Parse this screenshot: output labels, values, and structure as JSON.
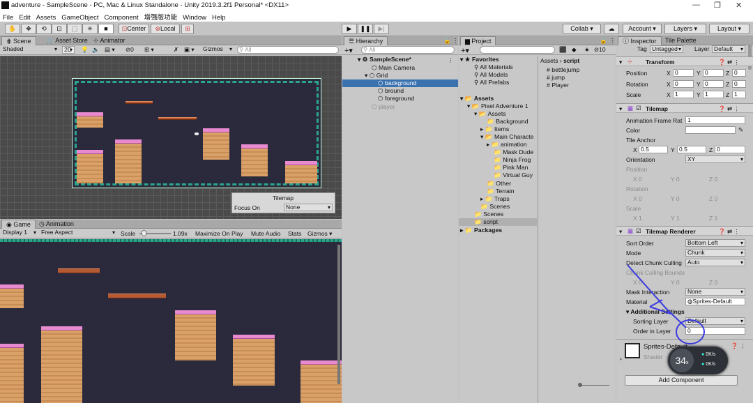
{
  "window": {
    "title": "adventure - SampleScene - PC, Mac & Linux Standalone - Unity 2019.3.2f1 Personal* <DX11>"
  },
  "menu": [
    "File",
    "Edit",
    "Assets",
    "GameObject",
    "Component",
    "增强版功能",
    "Window",
    "Help"
  ],
  "toolbar": {
    "center": "Center",
    "local": "Local",
    "collab": "Collab ▾",
    "account": "Account",
    "layers": "Layers",
    "layout": "Layout"
  },
  "scene": {
    "tabs": [
      "Scene",
      "Asset Store",
      "Animator"
    ],
    "shading": "Shaded",
    "mode2d": "2D",
    "hidden_count": "0",
    "gizmos": "Gizmos",
    "search_placeholder": "All",
    "tilemap_overlay": {
      "title": "Tilemap",
      "focus_label": "Focus On",
      "focus_value": "None"
    }
  },
  "game": {
    "tabs": [
      "Game",
      "Animation"
    ],
    "display": "Display 1",
    "aspect": "Free Aspect",
    "scale_label": "Scale",
    "scale_value": "1.09x",
    "maximize": "Maximize On Play",
    "mute": "Mute Audio",
    "stats": "Stats",
    "gizmos": "Gizmos"
  },
  "hierarchy": {
    "tab": "Hierarchy",
    "search_placeholder": "All",
    "items": [
      "SampleScene*",
      "Main Camera",
      "Grid",
      "background",
      "bround",
      "foreground",
      "player"
    ]
  },
  "project": {
    "tab": "Project",
    "hidden_count": "10",
    "tree": [
      "Favorites",
      "All Materials",
      "All Models",
      "All Prefabs",
      "Assets",
      "Pixel Adventure 1",
      "Assets",
      "Background",
      "Items",
      "Main Characte",
      "animation",
      "Mask Dude",
      "Ninja Frog",
      "Pink Man",
      "Virtual Guy",
      "Other",
      "Terrain",
      "Traps",
      "Scenes",
      "Scenes",
      "script",
      "Packages"
    ],
    "breadcrumb": [
      "Assets",
      "script"
    ],
    "files": [
      "bettlejump",
      "jump",
      "Player"
    ]
  },
  "inspector": {
    "tabs": [
      "Inspector",
      "Tile Palette"
    ],
    "tag_label": "Tag",
    "tag_value": "Untagged",
    "layer_label": "Layer",
    "layer_value": "Default",
    "transform": {
      "title": "Transform",
      "position": {
        "label": "Position",
        "x": "0",
        "y": "0",
        "z": "0"
      },
      "rotation": {
        "label": "Rotation",
        "x": "0",
        "y": "0",
        "z": "0"
      },
      "scale": {
        "label": "Scale",
        "x": "1",
        "y": "1",
        "z": "1"
      }
    },
    "tilemap": {
      "title": "Tilemap",
      "frame_rate_label": "Animation Frame Rat",
      "frame_rate": "1",
      "color_label": "Color",
      "anchor_label": "Tile Anchor",
      "anchor_x": "0.5",
      "anchor_y": "0.5",
      "anchor_z": "0",
      "orientation_label": "Orientation",
      "orientation": "XY",
      "position_label": "Position",
      "rotation_label": "Rotation",
      "scale_label": "Scale",
      "pos": [
        "0",
        "0",
        "0"
      ],
      "rot": [
        "0",
        "0",
        "0"
      ],
      "scl": [
        "1",
        "1",
        "1"
      ]
    },
    "renderer": {
      "title": "Tilemap Renderer",
      "sort_order_label": "Sort Order",
      "sort_order": "Bottom Left",
      "mode_label": "Mode",
      "mode": "Chunk",
      "culling_label": "Detect Chunk Culling",
      "culling": "Auto",
      "bounds_label": "Chunk Culling Bounds",
      "bounds": [
        "0",
        "0",
        "0"
      ],
      "mask_label": "Mask Interaction",
      "mask": "None",
      "material_label": "Material",
      "material": "Sprites-Default",
      "additional": "Additional Settings",
      "sorting_layer_label": "Sorting Layer",
      "sorting_layer": "Default",
      "order_label": "Order in Layer",
      "order": "0"
    },
    "material_preview": {
      "name": "Sprites-Default",
      "shader_label": "Shader"
    },
    "add_component": "Add Component"
  },
  "overlay": {
    "fps": "34",
    "fps_unit": "x",
    "net_up": "0K/s",
    "net_down": "0K/s"
  },
  "colors": {
    "selection": "#3a72b0",
    "annotation": "#3b3be0",
    "scene_bg": "#2b2a3d"
  }
}
